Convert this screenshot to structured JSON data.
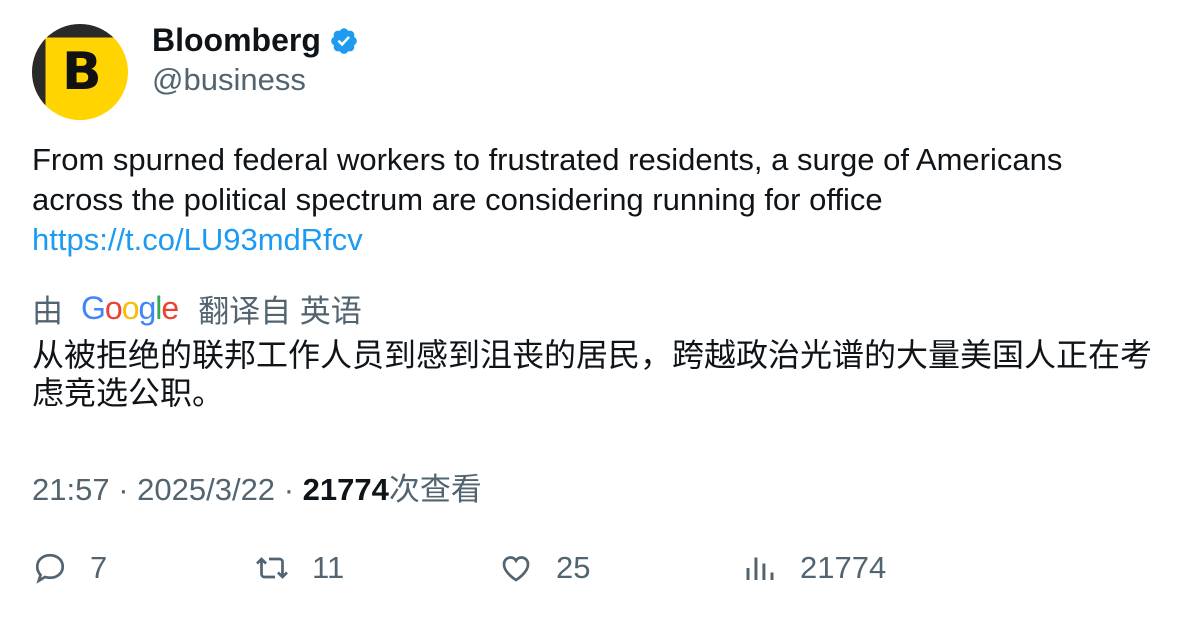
{
  "author": {
    "name": "Bloomberg",
    "handle": "@business",
    "avatar_letter": "B",
    "verified": true
  },
  "tweet": {
    "text": "From spurned federal workers to frustrated residents, a surge of Americans across the political spectrum are considering running for office",
    "link": "https://t.co/LU93mdRfcv"
  },
  "translation": {
    "by_label": "由",
    "provider": "Google",
    "from_label": "翻译自 英语",
    "text": "从被拒绝的联邦工作人员到感到沮丧的居民，跨越政治光谱的大量美国人正在考虑竞选公职。"
  },
  "meta": {
    "time": "21:57",
    "date": "2025/3/22",
    "views": "21774",
    "views_label": "次查看"
  },
  "actions": {
    "replies": "7",
    "retweets": "11",
    "likes": "25",
    "views": "21774"
  },
  "colors": {
    "link": "#1d9bf0",
    "secondary_text": "#536471",
    "brand_yellow": "#ffd400"
  }
}
